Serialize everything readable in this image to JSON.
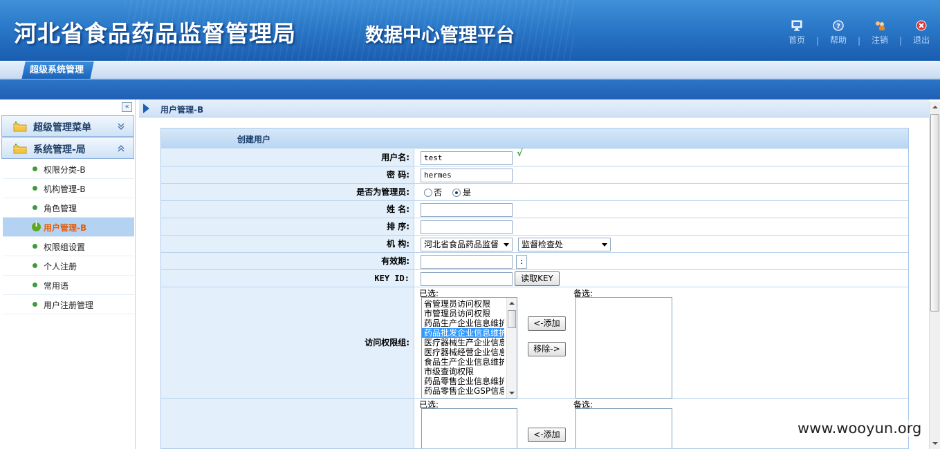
{
  "header": {
    "title": "河北省食品药品监督管理局",
    "subtitle": "数据中心管理平台",
    "nav": [
      {
        "label": "首页",
        "icon": "monitor-icon"
      },
      {
        "label": "帮助",
        "icon": "help-icon"
      },
      {
        "label": "注销",
        "icon": "users-icon"
      },
      {
        "label": "退出",
        "icon": "close-icon"
      }
    ]
  },
  "tabs": {
    "active": "超级系统管理"
  },
  "sidebar": {
    "collapse": "«",
    "menus": [
      {
        "label": "超级管理菜单",
        "expanded": false
      },
      {
        "label": "系统管理-局",
        "expanded": true
      }
    ],
    "items": [
      {
        "label": "权限分类-B"
      },
      {
        "label": "机构管理-B"
      },
      {
        "label": "角色管理"
      },
      {
        "label": "用户管理-B",
        "active": true
      },
      {
        "label": "权限组设置"
      },
      {
        "label": "个人注册"
      },
      {
        "label": "常用语"
      },
      {
        "label": "用户注册管理"
      }
    ]
  },
  "main": {
    "breadcrumb": "用户管理-B",
    "form_title": "创建用户",
    "fields": {
      "username_label": "用户名:",
      "username_value": "test",
      "check_mark": "√",
      "password_label": "密  码:",
      "password_value": "hermes",
      "is_admin_label": "是否为管理员:",
      "admin_no": "否",
      "admin_yes": "是",
      "admin_selected": "是",
      "name_label": "姓  名:",
      "name_value": "",
      "order_label": "排  序:",
      "order_value": "",
      "org_label": "机  构:",
      "org_select_1": "河北省食品药品监督",
      "org_select_2": "监督检查处",
      "validity_label": "有效期:",
      "validity_value": "",
      "validity_picker": ":",
      "keyid_label": "KEY ID:",
      "keyid_value": "",
      "read_key_button": "读取KEY"
    },
    "access_group": {
      "label": "访问权限组:",
      "selected_caption": "已选:",
      "available_caption": "备选:",
      "add_button": "<-添加",
      "remove_button": "移除->",
      "selected_options": [
        "省管理员访问权限",
        "市管理员访问权限",
        "药品生产企业信息维护",
        "药品批发企业信息维护",
        "医疗器械生产企业信息",
        "医疗器械经营企业信息",
        "食品生产企业信息维护",
        "市级查询权限",
        "药品零售企业信息维护",
        "药品零售企业GSP信息"
      ],
      "highlighted_option": "药品批发企业信息维护"
    },
    "second_group": {
      "selected_caption": "已选:",
      "available_caption": "备选:",
      "add_button": "<-添加"
    }
  },
  "watermark": "www.wooyun.org"
}
